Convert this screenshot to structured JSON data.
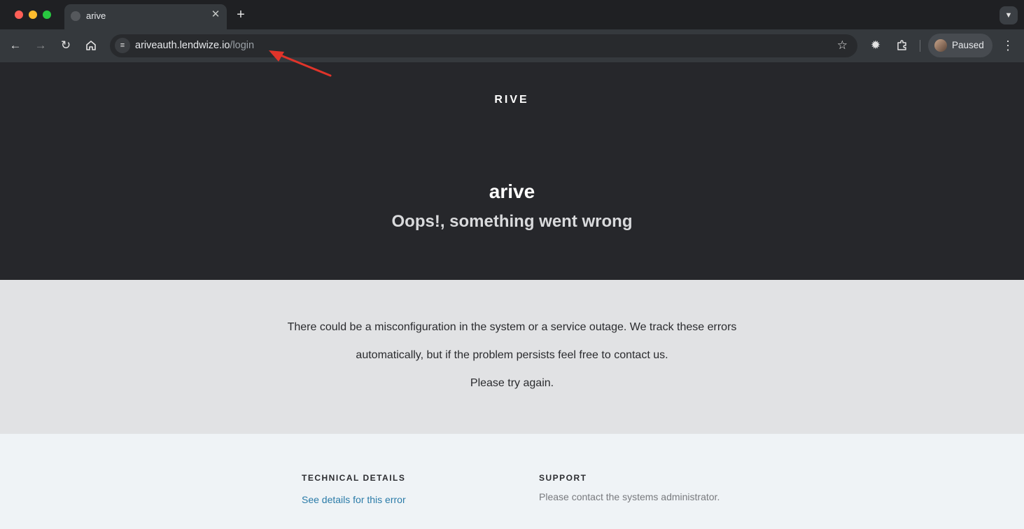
{
  "browser": {
    "tab": {
      "title": "arive"
    },
    "address": {
      "host": "ariveauth.lendwize.io",
      "path": "/login"
    },
    "profile": {
      "label": "Paused"
    },
    "icons": {
      "back": "arrow-left-icon",
      "forward": "arrow-right-icon",
      "reload": "reload-icon",
      "home": "home-icon",
      "site_info": "tune-icon",
      "bookmark": "star-icon",
      "extension": "puzzle-icon",
      "menu": "kebab-menu-icon"
    },
    "colors": {
      "frame": "#1f2023",
      "toolbar": "#35393d",
      "omnibox": "#282a2d"
    }
  },
  "page": {
    "logo_text": "RIVE",
    "title": "arive",
    "subtitle": "Oops!, something went wrong",
    "message": {
      "line1": "There could be a misconfiguration in the system or a service outage. We track these errors",
      "line2": "automatically, but if the problem persists feel free to contact us.",
      "line3": "Please try again."
    },
    "technical_details": {
      "heading": "TECHNICAL DETAILS",
      "link": "See details for this error"
    },
    "support": {
      "heading": "SUPPORT",
      "text": "Please contact the systems administrator."
    },
    "colors": {
      "hero": "#26272b",
      "message_bg": "#e1e2e4",
      "footer_bg": "#eff3f6",
      "link": "#2a7ba8"
    }
  },
  "annotation": {
    "color": "#e0342a"
  }
}
